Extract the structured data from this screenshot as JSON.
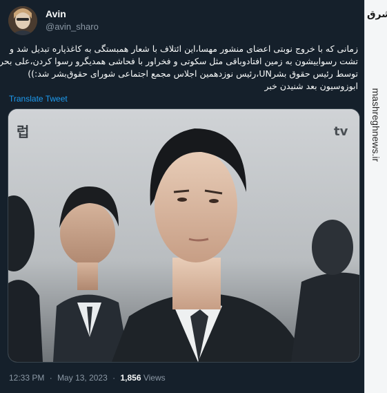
{
  "tweet": {
    "author_name": "Avin",
    "author_handle": "@avin_sharo",
    "body_lines": [
      "زمانی که با خروج نوبتی اعضای منشور مهسا،این ائتلاف با شعار همبستگی به کاغذپاره تبدیل شد و",
      "تشت رسواییشون به زمین افتادوباقی مثل سکوتی و فخراور با فحاشی همدیگرو رسوا کردن،علی بحرینی",
      "توسط رئیس حقوق بشرUN،رئیس نوزدهمین اجلاس مجمع اجتماعی شورای حقوق‌بشر شد:))",
      "ابوزوسیون بعد شنیدن خبر"
    ],
    "translate_label": "Translate Tweet",
    "time": "12:33 PM",
    "separator": "·",
    "date": "May 13, 2023",
    "views_count": "1,856",
    "views_label": "Views"
  },
  "watermark": {
    "logo_text": "مشرق",
    "site_text": "mashreghnews.ir"
  },
  "colors": {
    "background": "#15202b",
    "primary_text": "#f7f9f9",
    "secondary_text": "#8b98a5",
    "link": "#1d9bf0",
    "border": "#38444d"
  }
}
